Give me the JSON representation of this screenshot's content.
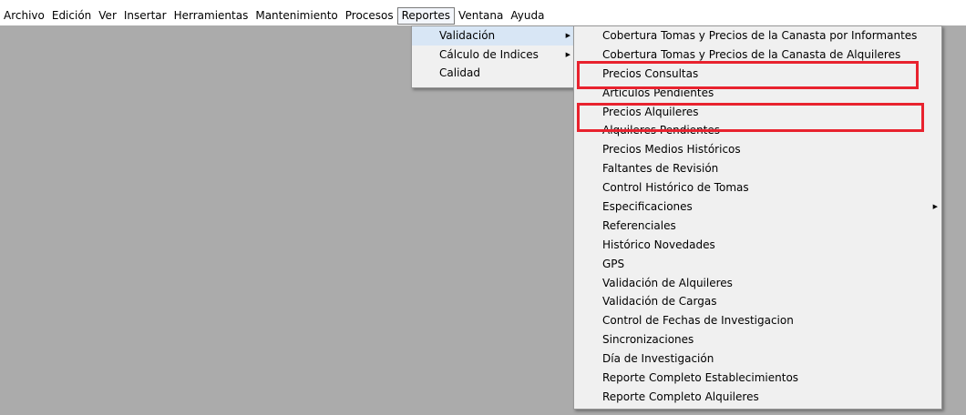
{
  "menubar": {
    "items": [
      "Archivo",
      "Edición",
      "Ver",
      "Insertar",
      "Herramientas",
      "Mantenimiento",
      "Procesos",
      "Reportes",
      "Ventana",
      "Ayuda"
    ],
    "active": "Reportes"
  },
  "reportes_menu": {
    "items": [
      {
        "label": "Validación",
        "submenu": true,
        "highlighted": true
      },
      {
        "label": "Cálculo de Indices",
        "submenu": true
      },
      {
        "label": "Calidad",
        "submenu": false
      }
    ]
  },
  "validacion_submenu": {
    "items": [
      {
        "label": "Cobertura Tomas y Precios de la Canasta por Informantes"
      },
      {
        "label": "Cobertura Tomas y Precios de la Canasta de Alquileres"
      },
      {
        "label": "Precios Consultas",
        "outlined": true
      },
      {
        "label": "Artículos Pendientes"
      },
      {
        "label": "Precios Alquileres",
        "outlined": true
      },
      {
        "label": "Alquileres Pendientes"
      },
      {
        "label": "Precios Medios Históricos"
      },
      {
        "label": "Faltantes de Revisión"
      },
      {
        "label": "Control Histórico de Tomas"
      },
      {
        "label": "Especificaciones",
        "submenu": true
      },
      {
        "label": "Referenciales"
      },
      {
        "label": "Histórico Novedades"
      },
      {
        "label": "GPS"
      },
      {
        "label": "Validación de Alquileres"
      },
      {
        "label": "Validación de Cargas"
      },
      {
        "label": "Control de Fechas de Investigacion"
      },
      {
        "label": "Sincronizaciones"
      },
      {
        "label": "Día de Investigación"
      },
      {
        "label": "Reporte Completo Establecimientos"
      },
      {
        "label": "Reporte Completo Alquileres"
      }
    ]
  },
  "annotation_color": "#e8222e"
}
